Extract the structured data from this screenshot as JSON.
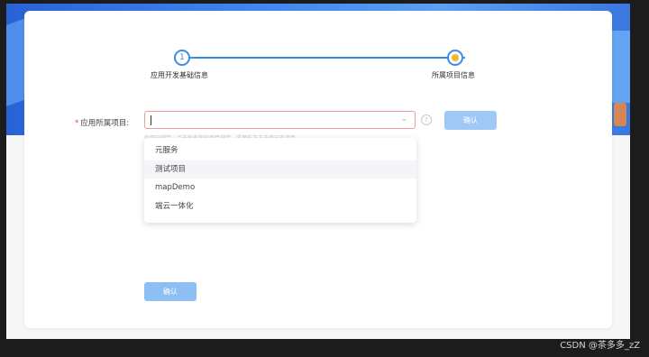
{
  "steps": [
    {
      "number": "1",
      "label": "应用开发基础信息"
    },
    {
      "label": "所属项目信息"
    }
  ],
  "form": {
    "required_mark": "*",
    "label": "应用所属项目:",
    "help_icon_glyph": "?",
    "confirm_label": "确认",
    "hint": "如您已绑定，点击所有您的项目绑定，或者在下方选择已有项目"
  },
  "dropdown": {
    "options": [
      "元服务",
      "测试项目",
      "mapDemo",
      "端云一体化"
    ],
    "hovered_index": 1
  },
  "footer": {
    "confirm_label": "确认"
  },
  "watermark": "CSDN @茶多多_zZ",
  "colors": {
    "primary": "#3a8ee6",
    "active_step_dot": "#f5b72a",
    "error_border": "#f09a9a",
    "button_disabled": "#9fc8f6"
  }
}
